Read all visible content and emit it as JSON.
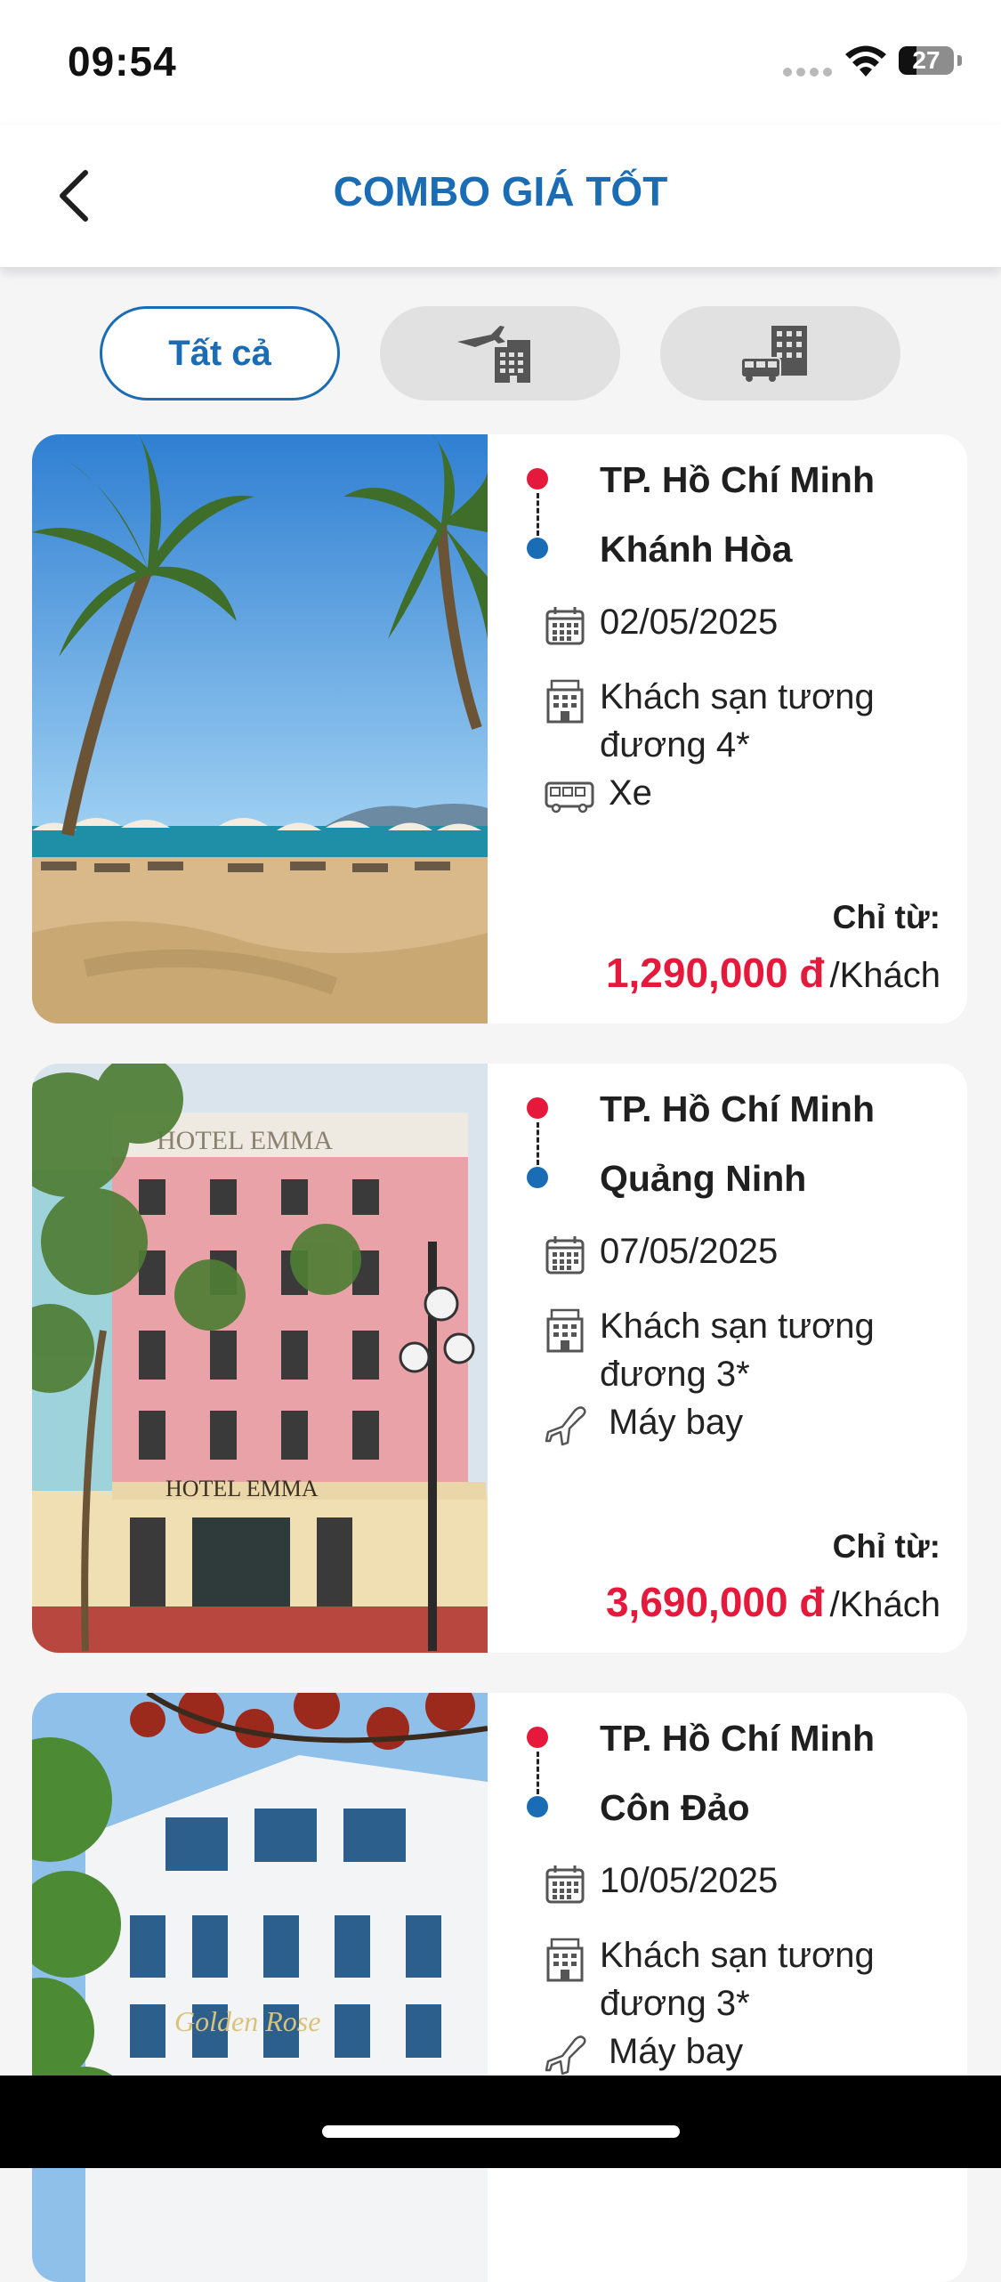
{
  "status_bar": {
    "time": "09:54",
    "battery": "27"
  },
  "header": {
    "title": "COMBO GIÁ TỐT",
    "back_icon": "chevron-left-icon"
  },
  "filters": {
    "all_label": "Tất cả",
    "flight_hotel_icon": "plane-hotel-icon",
    "bus_hotel_icon": "bus-hotel-icon",
    "selected": "all"
  },
  "colors": {
    "brand_blue": "#1a6cb5",
    "price_red": "#e5193c",
    "origin_dot": "#e5193c",
    "destination_dot": "#1a6cb5"
  },
  "combos": [
    {
      "origin": "TP. Hồ Chí Minh",
      "destination": "Khánh Hòa",
      "date": "02/05/2025",
      "hotel": "Khách sạn tương đương 4*",
      "transport": "Xe",
      "transport_icon": "bus-icon",
      "price_label": "Chỉ từ:",
      "price": "1,290,000 đ",
      "price_unit": "/Khách",
      "image": "beach-palm-trees-photo"
    },
    {
      "origin": "TP. Hồ Chí Minh",
      "destination": "Quảng Ninh",
      "date": "07/05/2025",
      "hotel": "Khách sạn tương đương 3*",
      "transport": "Máy bay",
      "transport_icon": "airplane-icon",
      "price_label": "Chỉ từ:",
      "price": "3,690,000 đ",
      "price_unit": "/Khách",
      "image": "hotel-emma-photo",
      "image_text": [
        "HOTEL EMMA",
        "HOTEL EMMA"
      ]
    },
    {
      "origin": "TP. Hồ Chí Minh",
      "destination": "Côn Đảo",
      "date": "10/05/2025",
      "hotel": "Khách sạn tương đương 3*",
      "transport": "Máy bay",
      "transport_icon": "airplane-icon",
      "image": "golden-rose-hotel-photo",
      "image_text": [
        "Golden Rose"
      ]
    }
  ]
}
